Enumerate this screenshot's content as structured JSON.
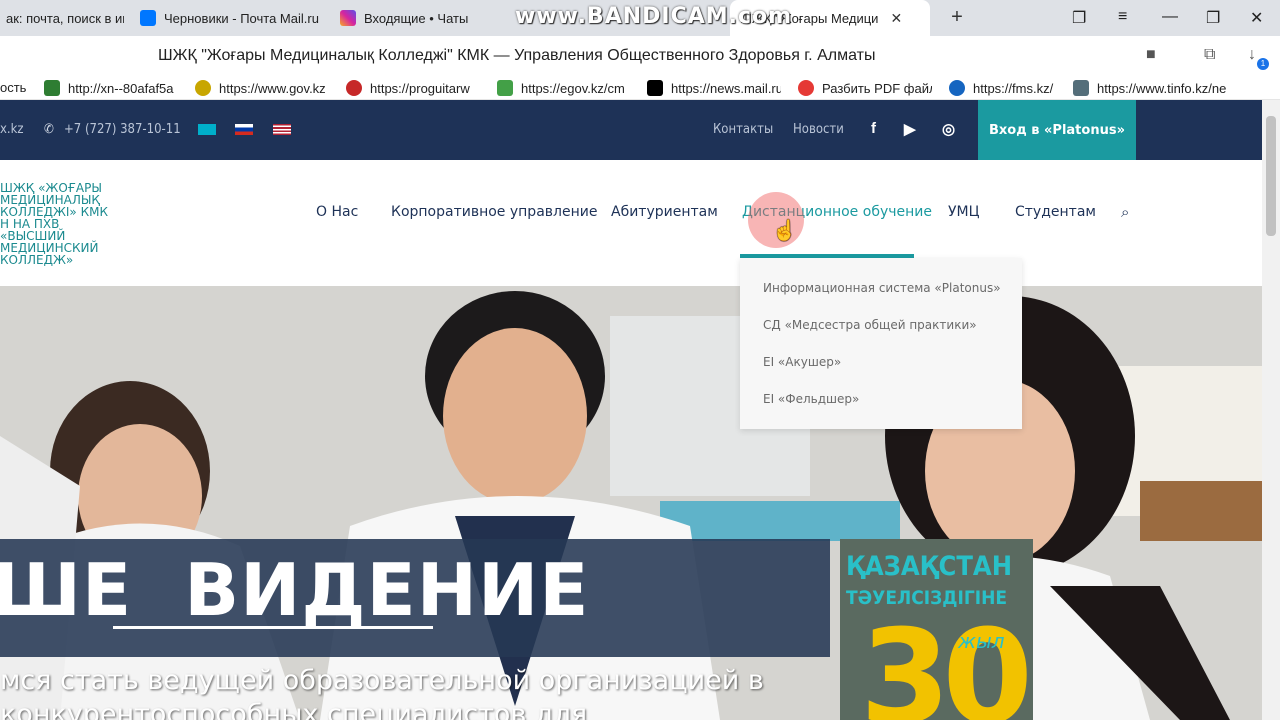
{
  "browser": {
    "tabs": [
      {
        "label": "ак: почта, поиск в инт",
        "icon": "search-icon",
        "color": "#f4c20d"
      },
      {
        "label": "Черновики - Почта Mail.ru",
        "icon": "mail-icon",
        "color": "#0077ff"
      },
      {
        "label": "Входящие • Чаты",
        "icon": "instagram-icon",
        "color": "#d6249f"
      },
      {
        "label": "ШЖҚ \"Жоғары Медици",
        "icon": "site-icon",
        "color": "#1b9aa0"
      }
    ],
    "new_tab": "+",
    "watermark": "www.BANDICAM.com",
    "page_title": "ШЖҚ \"Жоғары Медициналық Колледжі\" КМК — Управления Общественного Здоровья г. Алматы",
    "bookmarks": [
      {
        "label": "ость",
        "color": "#ffffff"
      },
      {
        "label": "http://xn--80afaf5a",
        "color": "#2e7d32"
      },
      {
        "label": "https://www.gov.kz",
        "color": "#c8a600"
      },
      {
        "label": "https://proguitarw",
        "color": "#c62828"
      },
      {
        "label": "https://egov.kz/cm",
        "color": "#43a047"
      },
      {
        "label": "https://news.mail.ru",
        "color": "#000000"
      },
      {
        "label": "Разбить PDF файл",
        "color": "#e53935"
      },
      {
        "label": "https://fms.kz/",
        "color": "#1565c0"
      },
      {
        "label": "https://www.tinfo.kz/ne",
        "color": "#546e7a"
      }
    ],
    "notification_count": "1"
  },
  "site": {
    "topbar": {
      "email_fragment": "x.kz",
      "phone": "+7 (727) 387-10-11",
      "contacts": "Контакты",
      "news": "Новости",
      "login_button": "Вход в «Platonus»"
    },
    "logo_lines": [
      "ШЖҚ «ЖОҒАРЫ",
      "МЕДИЦИНАЛЫҚ",
      "КОЛЛЕДЖІ» КМК",
      "Н на ПХВ",
      "«ВЫСШИЙ",
      "МЕДИЦИНСКИЙ",
      "КОЛЛЕДЖ»"
    ],
    "nav": [
      "О Нас",
      "Корпоративное управление",
      "Абитуриентам",
      "Дистанционное обучение",
      "УМЦ",
      "Студентам"
    ],
    "dropdown": [
      "Информационная система «Platonus»",
      "СД «Медсестра общей практики»",
      "ЕІ «Акушер»",
      "ЕІ «Фельдшер»"
    ],
    "hero": {
      "title_prefix": "ШЕ",
      "title": "ВИДЕНИЕ",
      "line1": "мся стать ведущей образовательной организацией в",
      "line2": "конкурентоспособных специалистов для",
      "poster_line1": "ҚАЗАҚСТАН",
      "poster_line2": "ТӘУЕЛСІЗДІГІНЕ",
      "poster_line3": "жыл",
      "poster_number": "30"
    },
    "colors": {
      "navy": "#1e3257",
      "teal": "#1b9aa0"
    }
  }
}
